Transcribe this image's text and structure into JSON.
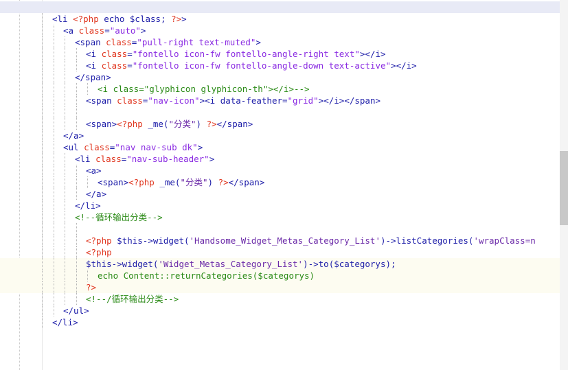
{
  "editor": {
    "lines": [
      {
        "indent": 0,
        "hl": "cur",
        "tokens": []
      },
      {
        "indent": 3,
        "tokens": [
          [
            "tag",
            "<li "
          ],
          [
            "php",
            "<?php"
          ],
          [
            "plain",
            " echo $class; "
          ],
          [
            "php",
            "?>"
          ],
          [
            "tag",
            ">"
          ]
        ]
      },
      {
        "indent": 4,
        "tokens": [
          [
            "tag",
            "<a "
          ],
          [
            "attr",
            "class"
          ],
          [
            "tag",
            "="
          ],
          [
            "str",
            "\"auto\""
          ],
          [
            "tag",
            ">"
          ]
        ]
      },
      {
        "indent": 5,
        "tokens": [
          [
            "tag",
            "<span "
          ],
          [
            "attr",
            "class"
          ],
          [
            "tag",
            "="
          ],
          [
            "str",
            "\"pull-right text-muted\""
          ],
          [
            "tag",
            ">"
          ]
        ]
      },
      {
        "indent": 6,
        "tokens": [
          [
            "tag",
            "<i "
          ],
          [
            "attr",
            "class"
          ],
          [
            "tag",
            "="
          ],
          [
            "str",
            "\"fontello icon-fw fontello-angle-right text\""
          ],
          [
            "tag",
            "></i>"
          ]
        ]
      },
      {
        "indent": 6,
        "tokens": [
          [
            "tag",
            "<i "
          ],
          [
            "attr",
            "class"
          ],
          [
            "tag",
            "="
          ],
          [
            "str",
            "\"fontello icon-fw fontello-angle-down text-active\""
          ],
          [
            "tag",
            "></i>"
          ]
        ]
      },
      {
        "indent": 5,
        "tokens": [
          [
            "tag",
            "</span>"
          ]
        ]
      },
      {
        "indent": 7,
        "tokens": [
          [
            "cmt",
            "<i class=\"glyphicon glyphicon-th\"></i>-->"
          ]
        ]
      },
      {
        "indent": 6,
        "tokens": [
          [
            "tag",
            "<span "
          ],
          [
            "attr",
            "class"
          ],
          [
            "tag",
            "="
          ],
          [
            "str",
            "\"nav-icon\""
          ],
          [
            "tag",
            "><i data-feather="
          ],
          [
            "str",
            "\"grid\""
          ],
          [
            "tag",
            "></i></span>"
          ]
        ]
      },
      {
        "indent": 6,
        "tokens": []
      },
      {
        "indent": 6,
        "tokens": [
          [
            "tag",
            "<span>"
          ],
          [
            "php",
            "<?php"
          ],
          [
            "plain",
            " _me("
          ],
          [
            "ftxt",
            "\"分类\""
          ],
          [
            "plain",
            ") "
          ],
          [
            "php",
            "?>"
          ],
          [
            "tag",
            "</span>"
          ]
        ]
      },
      {
        "indent": 4,
        "tokens": [
          [
            "tag",
            "</a>"
          ]
        ]
      },
      {
        "indent": 4,
        "tokens": [
          [
            "tag",
            "<ul "
          ],
          [
            "attr",
            "class"
          ],
          [
            "tag",
            "="
          ],
          [
            "str",
            "\"nav nav-sub dk\""
          ],
          [
            "tag",
            ">"
          ]
        ]
      },
      {
        "indent": 5,
        "tokens": [
          [
            "tag",
            "<li "
          ],
          [
            "attr",
            "class"
          ],
          [
            "tag",
            "="
          ],
          [
            "str",
            "\"nav-sub-header\""
          ],
          [
            "tag",
            ">"
          ]
        ]
      },
      {
        "indent": 6,
        "tokens": [
          [
            "tag",
            "<a>"
          ]
        ]
      },
      {
        "indent": 7,
        "tokens": [
          [
            "tag",
            "<span>"
          ],
          [
            "php",
            "<?php"
          ],
          [
            "plain",
            " _me("
          ],
          [
            "ftxt",
            "\"分类\""
          ],
          [
            "plain",
            ") "
          ],
          [
            "php",
            "?>"
          ],
          [
            "tag",
            "</span>"
          ]
        ]
      },
      {
        "indent": 6,
        "tokens": [
          [
            "tag",
            "</a>"
          ]
        ]
      },
      {
        "indent": 5,
        "tokens": [
          [
            "tag",
            "</li>"
          ]
        ]
      },
      {
        "indent": 5,
        "tokens": [
          [
            "cmt",
            "<!--循环输出分类-->"
          ]
        ]
      },
      {
        "indent": 6,
        "tokens": []
      },
      {
        "indent": 6,
        "tokens": [
          [
            "php",
            "<?php"
          ],
          [
            "plain",
            " $this->widget("
          ],
          [
            "ftxt",
            "'Handsome_Widget_Metas_Category_List'"
          ],
          [
            "plain",
            ")->listCategories("
          ],
          [
            "ftxt",
            "'wrapClass=n"
          ]
        ]
      },
      {
        "indent": 6,
        "tokens": [
          [
            "php",
            "<?php"
          ]
        ]
      },
      {
        "indent": 6,
        "hl": "php",
        "tokens": [
          [
            "var",
            "$this->widget("
          ],
          [
            "ftxt",
            "'Widget_Metas_Category_List'"
          ],
          [
            "var",
            ")->to($categorys);"
          ]
        ]
      },
      {
        "indent": 7,
        "hl": "php",
        "tokens": [
          [
            "cmt",
            "echo Content::returnCategories($categorys)"
          ]
        ]
      },
      {
        "indent": 6,
        "hl": "php",
        "tokens": [
          [
            "php",
            "?>"
          ]
        ]
      },
      {
        "indent": 6,
        "tokens": [
          [
            "cmt",
            "<!--/循环输出分类-->"
          ]
        ]
      },
      {
        "indent": 4,
        "tokens": [
          [
            "tag",
            "</ul>"
          ]
        ]
      },
      {
        "indent": 3,
        "tokens": [
          [
            "tag",
            "</li>"
          ]
        ]
      }
    ]
  },
  "colors": {
    "tag": "#1c1ca8",
    "attr": "#e0351e",
    "string": "#8a2be2",
    "comment": "#2a8a16",
    "php": "#e0351e",
    "current_line": "#e8eaf6"
  }
}
